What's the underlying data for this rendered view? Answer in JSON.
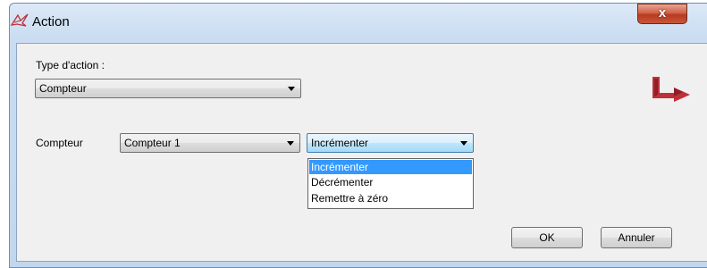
{
  "window": {
    "title": "Action",
    "close_label": "x"
  },
  "form": {
    "type_label": "Type d'action :",
    "type_value": "Compteur",
    "counter_label": "Compteur",
    "counter_value": "Compteur 1",
    "operation_value": "Incrémenter"
  },
  "dropdown": {
    "options": [
      "Incrémenter",
      "Décrémenter",
      "Remettre à zéro"
    ],
    "selected_index": 0
  },
  "buttons": {
    "ok": "OK",
    "cancel": "Annuler"
  },
  "icons": {
    "title": "action-icon",
    "logo": "arrow-logo-icon"
  },
  "colors": {
    "selection": "#3399ff",
    "logo": "#c0303a",
    "close": "#c8573a"
  }
}
